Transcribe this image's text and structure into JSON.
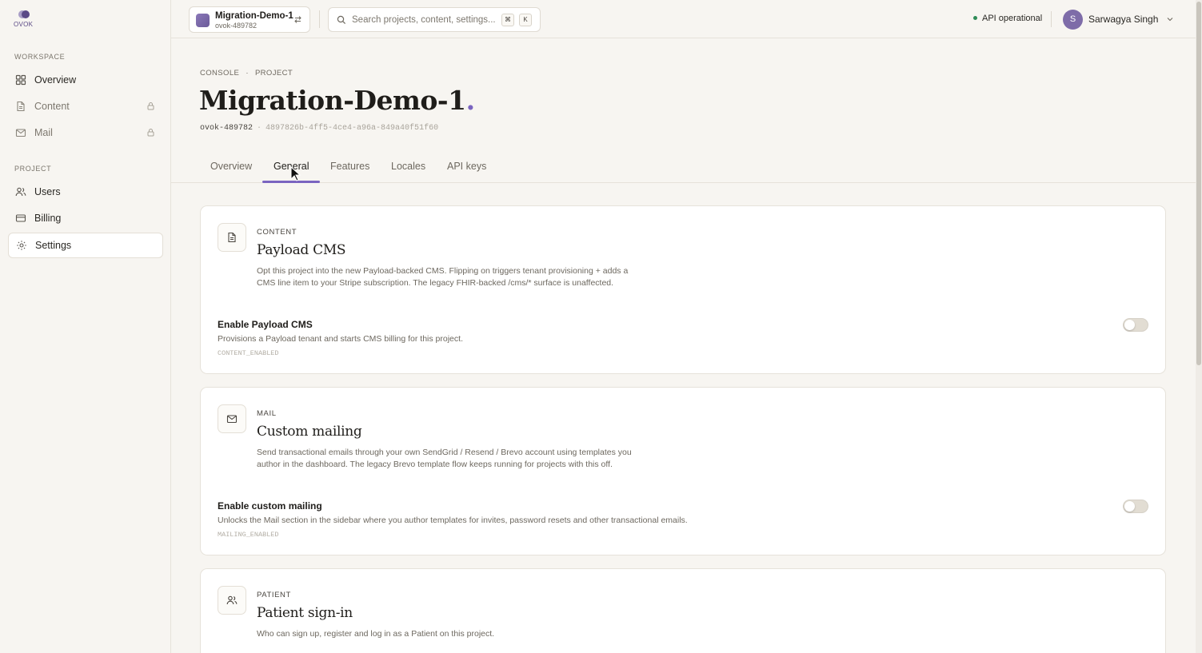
{
  "brand": {
    "name": "OVOK"
  },
  "sidebar": {
    "workspace_label": "WORKSPACE",
    "project_label": "PROJECT",
    "workspace_items": [
      {
        "label": "Overview",
        "icon": "grid-icon",
        "locked": false
      },
      {
        "label": "Content",
        "icon": "document-icon",
        "locked": true
      },
      {
        "label": "Mail",
        "icon": "mail-icon",
        "locked": true
      }
    ],
    "project_items": [
      {
        "label": "Users",
        "icon": "users-icon"
      },
      {
        "label": "Billing",
        "icon": "card-icon"
      },
      {
        "label": "Settings",
        "icon": "gear-icon",
        "active": true
      }
    ]
  },
  "topbar": {
    "project_name": "Migration-Demo-1",
    "project_id": "ovok-489782",
    "search_placeholder": "Search projects, content, settings...",
    "shortcut_keys": [
      "⌘",
      "K"
    ],
    "api_status": "API operational",
    "user": {
      "name": "Sarwagya Singh",
      "initial": "S"
    }
  },
  "header": {
    "breadcrumb": [
      "CONSOLE",
      "PROJECT"
    ],
    "breadcrumb_sep": "·",
    "title": "Migration-Demo-1",
    "title_accent": ".",
    "project_id": "ovok-489782",
    "id_sep": "·",
    "uuid": "4897826b-4ff5-4ce4-a96a-849a40f51f60"
  },
  "tabs": [
    {
      "label": "Overview"
    },
    {
      "label": "General",
      "active": true
    },
    {
      "label": "Features"
    },
    {
      "label": "Locales"
    },
    {
      "label": "API keys"
    }
  ],
  "cards": [
    {
      "kicker": "CONTENT",
      "title": "Payload CMS",
      "description": "Opt this project into the new Payload-backed CMS. Flipping on triggers tenant provisioning + adds a CMS line item to your Stripe subscription. The legacy FHIR-backed /cms/* surface is unaffected.",
      "setting_title": "Enable Payload CMS",
      "setting_desc": "Provisions a Payload tenant and starts CMS billing for this project.",
      "setting_key": "CONTENT_ENABLED",
      "enabled": false
    },
    {
      "kicker": "MAIL",
      "title": "Custom mailing",
      "description": "Send transactional emails through your own SendGrid / Resend / Brevo account using templates you author in the dashboard. The legacy Brevo template flow keeps running for projects with this off.",
      "setting_title": "Enable custom mailing",
      "setting_desc": "Unlocks the Mail section in the sidebar where you author templates for invites, password resets and other transactional emails.",
      "setting_key": "MAILING_ENABLED",
      "enabled": false
    },
    {
      "kicker": "PATIENT",
      "title": "Patient sign-in",
      "description": "Who can sign up, register and log in as a Patient on this project."
    }
  ],
  "colors": {
    "accent": "#7a64c0",
    "status_ok": "#2e8b57",
    "background": "#f7f5f1"
  }
}
